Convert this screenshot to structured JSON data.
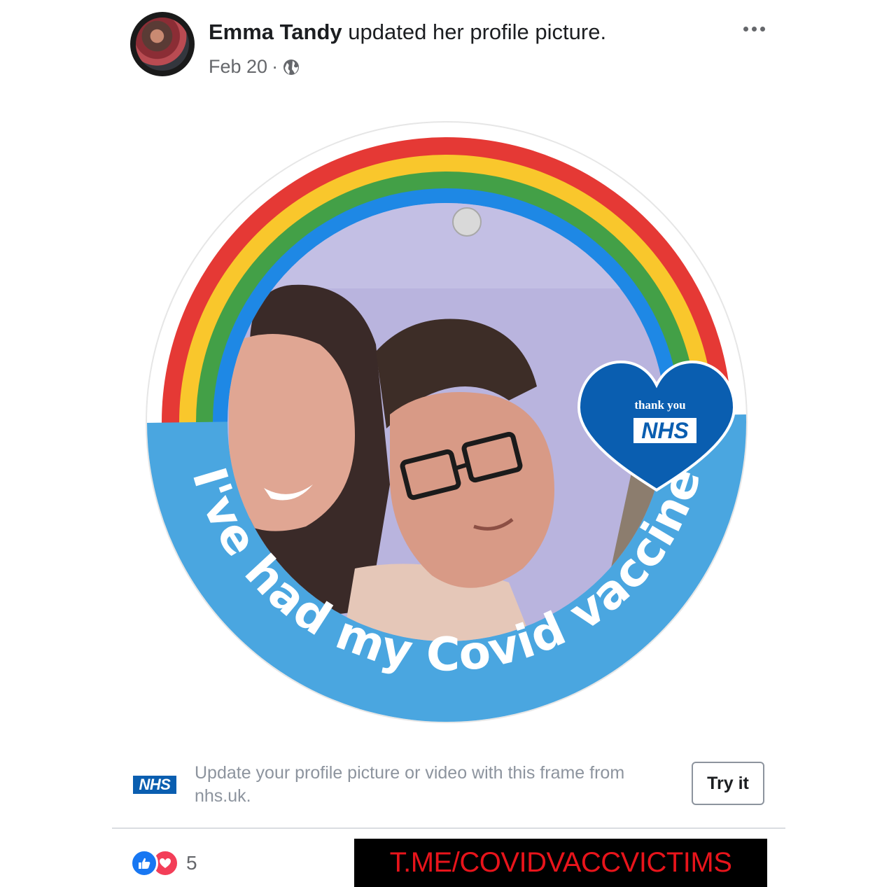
{
  "post": {
    "author_name": "Emma Tandy",
    "action_text": "updated her profile picture.",
    "date": "Feb 20",
    "separator": "·",
    "privacy_icon": "globe-icon",
    "menu_icon": "more-horizontal-icon"
  },
  "frame": {
    "badge_line1": "thank you",
    "badge_logo": "NHS",
    "curved_text": "I've had my Covid vaccine",
    "colors": {
      "rainbow": [
        "#e53935",
        "#f9c72c",
        "#43a047",
        "#1e88e5"
      ],
      "band": "#4aa6e0",
      "badge": "#0a5eb0"
    }
  },
  "frame_promo": {
    "logo": "NHS",
    "description": "Update your profile picture or video with this frame from nhs.uk.",
    "button_label": "Try it"
  },
  "reactions": {
    "icons": [
      "like-icon",
      "love-icon"
    ],
    "count": "5"
  },
  "watermark": {
    "text": "T.ME/COVIDVACCVICTIMS",
    "color": "#e8141b"
  }
}
